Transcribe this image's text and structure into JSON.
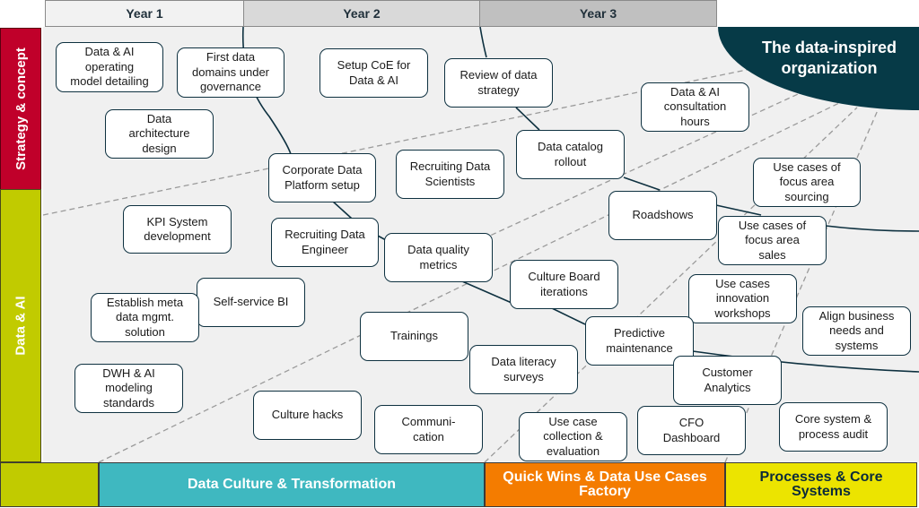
{
  "years": [
    "Year 1",
    "Year 2",
    "Year 3"
  ],
  "rows": {
    "strategy": "Strategy & concept",
    "data_ai": "Data & AI"
  },
  "bands": {
    "culture": "Data Culture & Transformation",
    "quick_wins": "Quick Wins & Data Use Cases\nFactory",
    "processes": "Processes & Core\nSystems"
  },
  "goal": "The data-inspired\norganization",
  "colors": {
    "strategy": "#c0002a",
    "data_ai": "#c1cb00",
    "culture": "#3fb8c0",
    "quick_wins": "#f47c00",
    "processes": "#ece400",
    "goal": "#063a47"
  },
  "nodes": [
    {
      "id": "op-model",
      "label": "Data & AI\noperating\nmodel detailing"
    },
    {
      "id": "first-domains",
      "label": "First data\ndomains under\ngovernance"
    },
    {
      "id": "setup-coe",
      "label": "Setup CoE for\nData & AI"
    },
    {
      "id": "review-strategy",
      "label": "Review of data\nstrategy"
    },
    {
      "id": "consultation",
      "label": "Data & AI\nconsultation\nhours"
    },
    {
      "id": "arch-design",
      "label": "Data\narchitecture\ndesign"
    },
    {
      "id": "catalog",
      "label": "Data catalog\nrollout"
    },
    {
      "id": "corp-platform",
      "label": "Corporate Data\nPlatform setup"
    },
    {
      "id": "recruit-ds",
      "label": "Recruiting Data\nScientists"
    },
    {
      "id": "uc-sourcing",
      "label": "Use cases of\nfocus area\nsourcing"
    },
    {
      "id": "roadshows",
      "label": "Roadshows"
    },
    {
      "id": "kpi",
      "label": "KPI System\ndevelopment"
    },
    {
      "id": "recruit-de",
      "label": "Recruiting Data\nEngineer"
    },
    {
      "id": "uc-sales",
      "label": "Use cases of\nfocus area\nsales"
    },
    {
      "id": "dq-metrics",
      "label": "Data quality\nmetrics"
    },
    {
      "id": "culture-board",
      "label": "Culture Board\niterations"
    },
    {
      "id": "self-service",
      "label": "Self-service BI"
    },
    {
      "id": "metadata",
      "label": "Establish meta\ndata mgmt.\nsolution"
    },
    {
      "id": "uc-innovation",
      "label": "Use cases\ninnovation\nworkshops"
    },
    {
      "id": "align-business",
      "label": "Align business\nneeds and\nsystems"
    },
    {
      "id": "trainings",
      "label": "Trainings"
    },
    {
      "id": "predictive",
      "label": "Predictive\nmaintenance"
    },
    {
      "id": "literacy",
      "label": "Data literacy\nsurveys"
    },
    {
      "id": "customer",
      "label": "Customer\nAnalytics"
    },
    {
      "id": "dwh",
      "label": "DWH & AI\nmodeling\nstandards"
    },
    {
      "id": "culture-hacks",
      "label": "Culture hacks"
    },
    {
      "id": "communication",
      "label": "Communi-\ncation"
    },
    {
      "id": "uc-collection",
      "label": "Use case\ncollection &\nevaluation"
    },
    {
      "id": "cfo",
      "label": "CFO\nDashboard"
    },
    {
      "id": "core-audit",
      "label": "Core system &\nprocess audit"
    }
  ]
}
